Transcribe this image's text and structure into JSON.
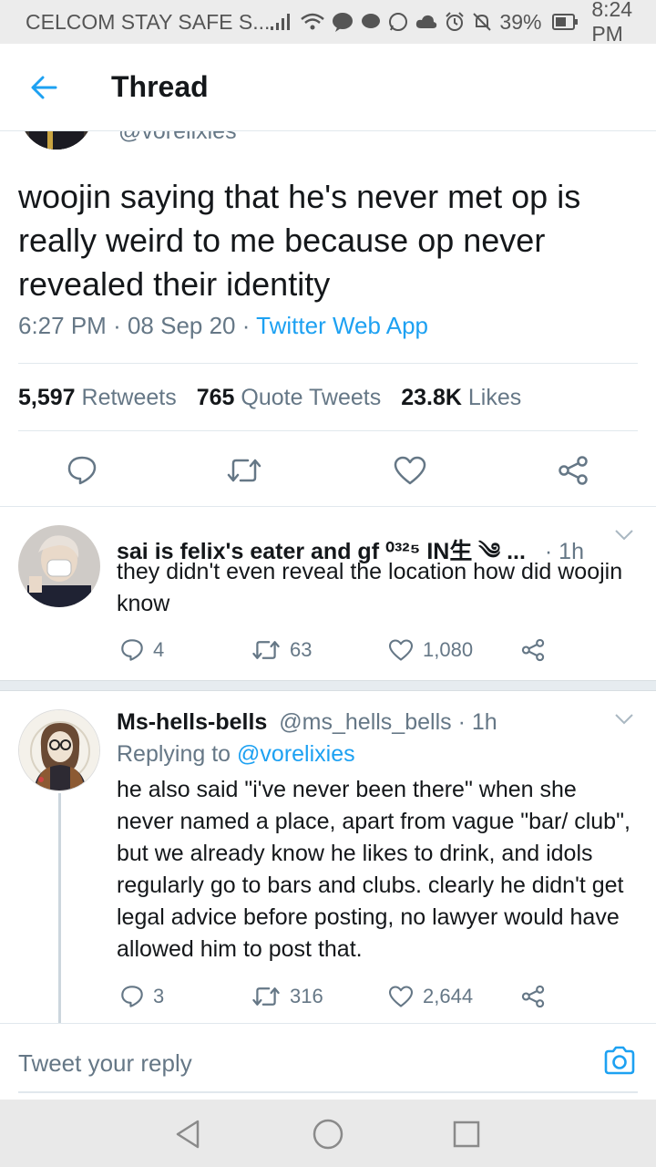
{
  "status_bar": {
    "carrier": "CELCOM STAY SAFE S...",
    "battery_percent": "39%",
    "battery_level": 0.39,
    "time": "8:24 PM"
  },
  "header": {
    "title": "Thread"
  },
  "main_tweet": {
    "handle_clipped": "@vorelixies",
    "text": "woojin saying that he's never met op is really weird to me because op never revealed their identity",
    "time": "6:27 PM",
    "date": "08 Sep 20",
    "app": "Twitter Web App",
    "retweets_count": "5,597",
    "retweets_label": "Retweets",
    "quotes_count": "765",
    "quotes_label": "Quote Tweets",
    "likes_count": "23.8K",
    "likes_label": "Likes"
  },
  "replies": [
    {
      "name": "sai is felix's eater and gf ⁰³²⁵ IN生 ༄ ...",
      "time": "· 1h",
      "text": "they didn't even reveal the location how did woojin know",
      "reply_count": "4",
      "retweet_count": "63",
      "like_count": "1,080"
    },
    {
      "name": "Ms-hells-bells",
      "handle": "@ms_hells_bells · 1h",
      "replying_prefix": "Replying to",
      "replying_to": "@vorelixies",
      "text": "he also said \"i've never been there\" when she never named a place, apart from vague \"bar/ club\", but we already know he likes to drink, and idols regularly go to bars and clubs. clearly he didn't get legal advice before posting, no lawyer would have allowed him to post that.",
      "reply_count": "3",
      "retweet_count": "316",
      "like_count": "2,644"
    }
  ],
  "reply_bar": {
    "placeholder": "Tweet your reply"
  },
  "colors": {
    "accent": "#1da1f2",
    "text": "#14171a",
    "muted": "#657786"
  }
}
